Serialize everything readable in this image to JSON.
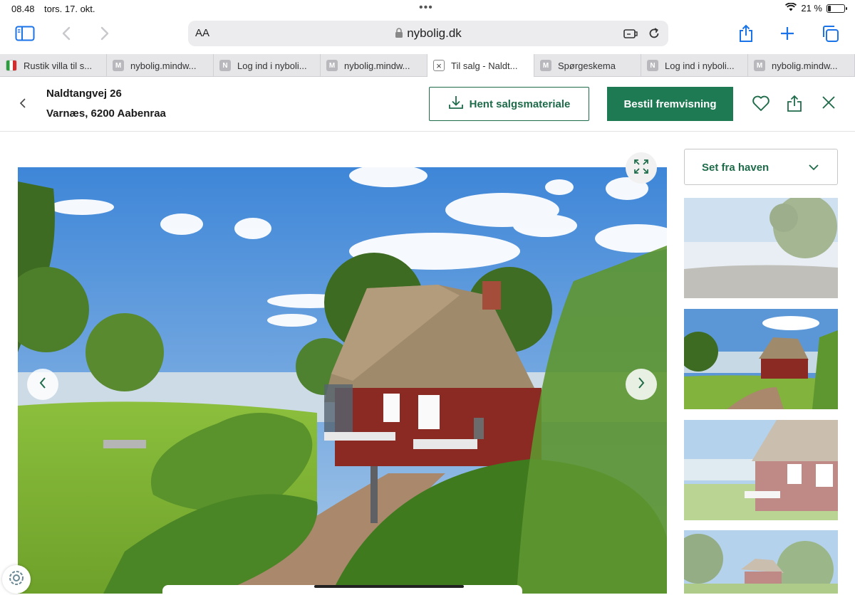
{
  "status_bar": {
    "time": "08.48",
    "date": "tors. 17. okt.",
    "battery": "21 %",
    "battery_level": 0.21
  },
  "browser": {
    "text_size_label": "AA",
    "url": "nybolig.dk",
    "tabs": [
      {
        "label": "Rustik villa til s...",
        "favicon": "flag-icon",
        "active": false
      },
      {
        "label": "nybolig.mindw...",
        "favicon": "M",
        "active": false
      },
      {
        "label": "Log ind i nyboli...",
        "favicon": "N",
        "active": false
      },
      {
        "label": "nybolig.mindw...",
        "favicon": "M",
        "active": false
      },
      {
        "label": "Til salg - Naldt...",
        "favicon": "close-icon",
        "active": true
      },
      {
        "label": "Spørgeskema",
        "favicon": "M",
        "active": false
      },
      {
        "label": "Log ind i nyboli...",
        "favicon": "N",
        "active": false
      },
      {
        "label": "nybolig.mindw...",
        "favicon": "M",
        "active": false
      }
    ]
  },
  "header": {
    "street": "Naldtangvej 26",
    "city": "Varnæs, 6200 Aabenraa",
    "download_label": "Hent salgsmateriale",
    "book_label": "Bestil fremvisning"
  },
  "gallery": {
    "dropdown_label": "Set fra haven",
    "colors": {
      "brand_green": "#1e7a52",
      "brand_text_green": "#1e6b4a"
    }
  }
}
